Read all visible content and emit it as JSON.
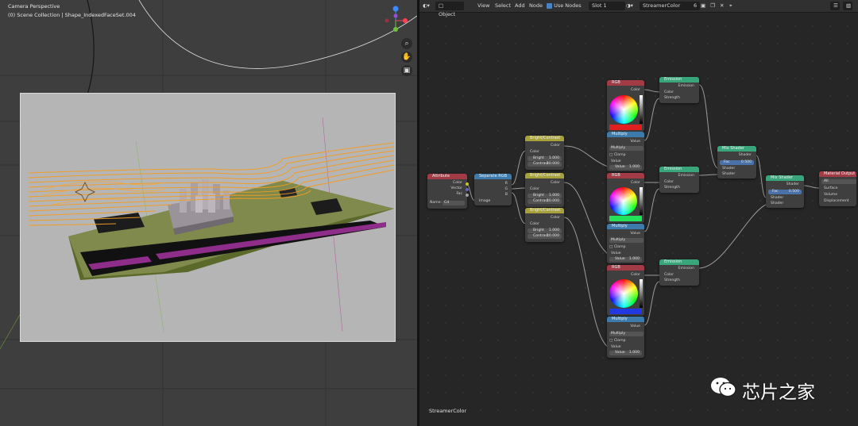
{
  "viewport": {
    "title": "Camera Perspective",
    "collection": "(0) Scene Collection | Shape_IndexedFaceSet.004"
  },
  "header": {
    "mode": "Object",
    "menu_view": "View",
    "menu_select": "Select",
    "menu_add": "Add",
    "menu_node": "Node",
    "use_nodes": "Use Nodes",
    "slot": "Slot 1",
    "material": "StreamerColor",
    "users": "6"
  },
  "editor": {
    "label": "StreamerColor"
  },
  "nodes": {
    "attribute": {
      "title": "Attribute",
      "out1": "Color",
      "out2": "Vector",
      "out3": "Fac",
      "name_label": "Name:",
      "name_value": "Cd"
    },
    "separate_rgb": {
      "title": "Separate RGB",
      "out1": "R",
      "out2": "G",
      "out3": "B",
      "in1": "Image"
    },
    "bc1": {
      "title": "Bright/Contrast",
      "out": "Color",
      "in1": "Color",
      "bright": "Bright",
      "bright_val": "1.000",
      "contrast": "Contrast",
      "contrast_val": "10.000"
    },
    "bc2": {
      "title": "Bright/Contrast",
      "out": "Color",
      "in1": "Color",
      "bright": "Bright",
      "bright_val": "1.000",
      "contrast": "Contrast",
      "contrast_val": "10.000"
    },
    "bc3": {
      "title": "Bright/Contrast",
      "out": "Color",
      "in1": "Color",
      "bright": "Bright",
      "bright_val": "1.000",
      "contrast": "Contrast",
      "contrast_val": "10.000"
    },
    "rgb1": {
      "title": "RGB",
      "out": "Color"
    },
    "rgb2": {
      "title": "RGB",
      "out": "Color"
    },
    "rgb3": {
      "title": "RGB",
      "out": "Color"
    },
    "mul1": {
      "title": "Multiply",
      "out": "Value",
      "op": "Multiply",
      "clamp": "Clamp",
      "in1": "Value",
      "value": "Value",
      "value_val": "1.000"
    },
    "mul2": {
      "title": "Multiply",
      "out": "Value",
      "op": "Multiply",
      "clamp": "Clamp",
      "in1": "Value",
      "value": "Value",
      "value_val": "1.000"
    },
    "mul3": {
      "title": "Multiply",
      "out": "Value",
      "op": "Multiply",
      "clamp": "Clamp",
      "in1": "Value",
      "value": "Value",
      "value_val": "1.000"
    },
    "em1": {
      "title": "Emission",
      "out": "Emission",
      "in1": "Color",
      "in2": "Strength"
    },
    "em2": {
      "title": "Emission",
      "out": "Emission",
      "in1": "Color",
      "in2": "Strength"
    },
    "em3": {
      "title": "Emission",
      "out": "Emission",
      "in1": "Color",
      "in2": "Strength"
    },
    "mix1": {
      "title": "Mix Shader",
      "out": "Shader",
      "fac": "Fac",
      "fac_val": "0.500",
      "in1": "Shader",
      "in2": "Shader"
    },
    "mix2": {
      "title": "Mix Shader",
      "out": "Shader",
      "fac": "Fac",
      "fac_val": "0.500",
      "in1": "Shader",
      "in2": "Shader"
    },
    "output": {
      "title": "Material Output",
      "target": "All",
      "in1": "Surface",
      "in2": "Volume",
      "in3": "Displacement"
    }
  },
  "watermark": {
    "text": "芯片之家"
  },
  "colors": {
    "input_header": "#a33b46",
    "converter_header": "#3d7bac",
    "color_header": "#a7a13c",
    "shader_header": "#38a57a",
    "output_header": "#a33b46",
    "streamer": "#f59c21"
  }
}
